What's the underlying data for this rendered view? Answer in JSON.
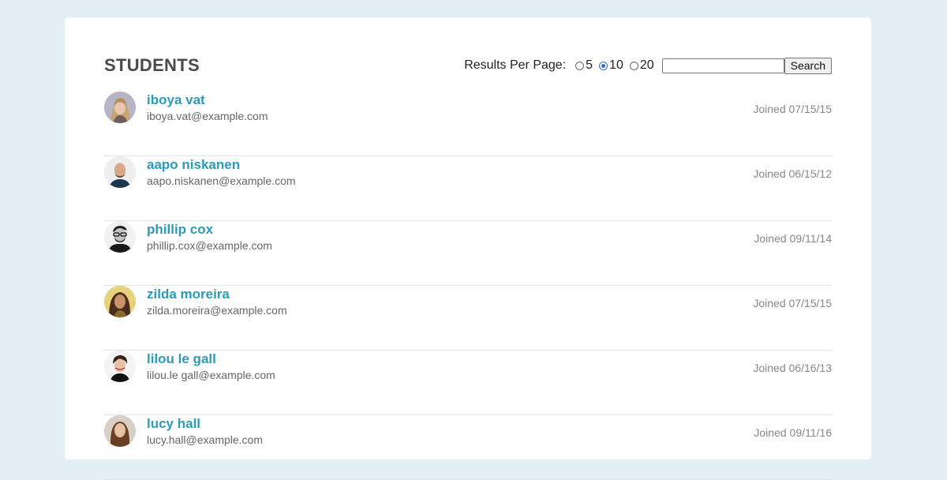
{
  "header": {
    "title": "STUDENTS",
    "results_per_page_label": "Results Per Page:",
    "page_size_options": [
      {
        "label": "5",
        "selected": false
      },
      {
        "label": "10",
        "selected": true
      },
      {
        "label": "20",
        "selected": false
      }
    ],
    "search_value": "",
    "search_button_label": "Search"
  },
  "colors": {
    "background": "#e2f0f5",
    "card": "#ffffff",
    "name_link": "#2b9bb8",
    "title": "#4a4a4a",
    "radio_accent": "#2f6fd0"
  },
  "students": [
    {
      "name": "iboya vat",
      "email": "iboya.vat@example.com",
      "joined": "Joined 07/15/15",
      "avatar": "avatar-woman-blonde"
    },
    {
      "name": "aapo niskanen",
      "email": "aapo.niskanen@example.com",
      "joined": "Joined 06/15/12",
      "avatar": "avatar-man-bald-beard"
    },
    {
      "name": "phillip cox",
      "email": "phillip.cox@example.com",
      "joined": "Joined 09/11/14",
      "avatar": "avatar-man-glasses-bw"
    },
    {
      "name": "zilda moreira",
      "email": "zilda.moreira@example.com",
      "joined": "Joined 07/15/15",
      "avatar": "avatar-woman-dark-hair"
    },
    {
      "name": "lilou le gall",
      "email": "lilou.le gall@example.com",
      "joined": "Joined 06/16/13",
      "avatar": "avatar-woman-short-hair"
    },
    {
      "name": "lucy hall",
      "email": "lucy.hall@example.com",
      "joined": "Joined 09/11/16",
      "avatar": "avatar-woman-brown-hair"
    }
  ]
}
